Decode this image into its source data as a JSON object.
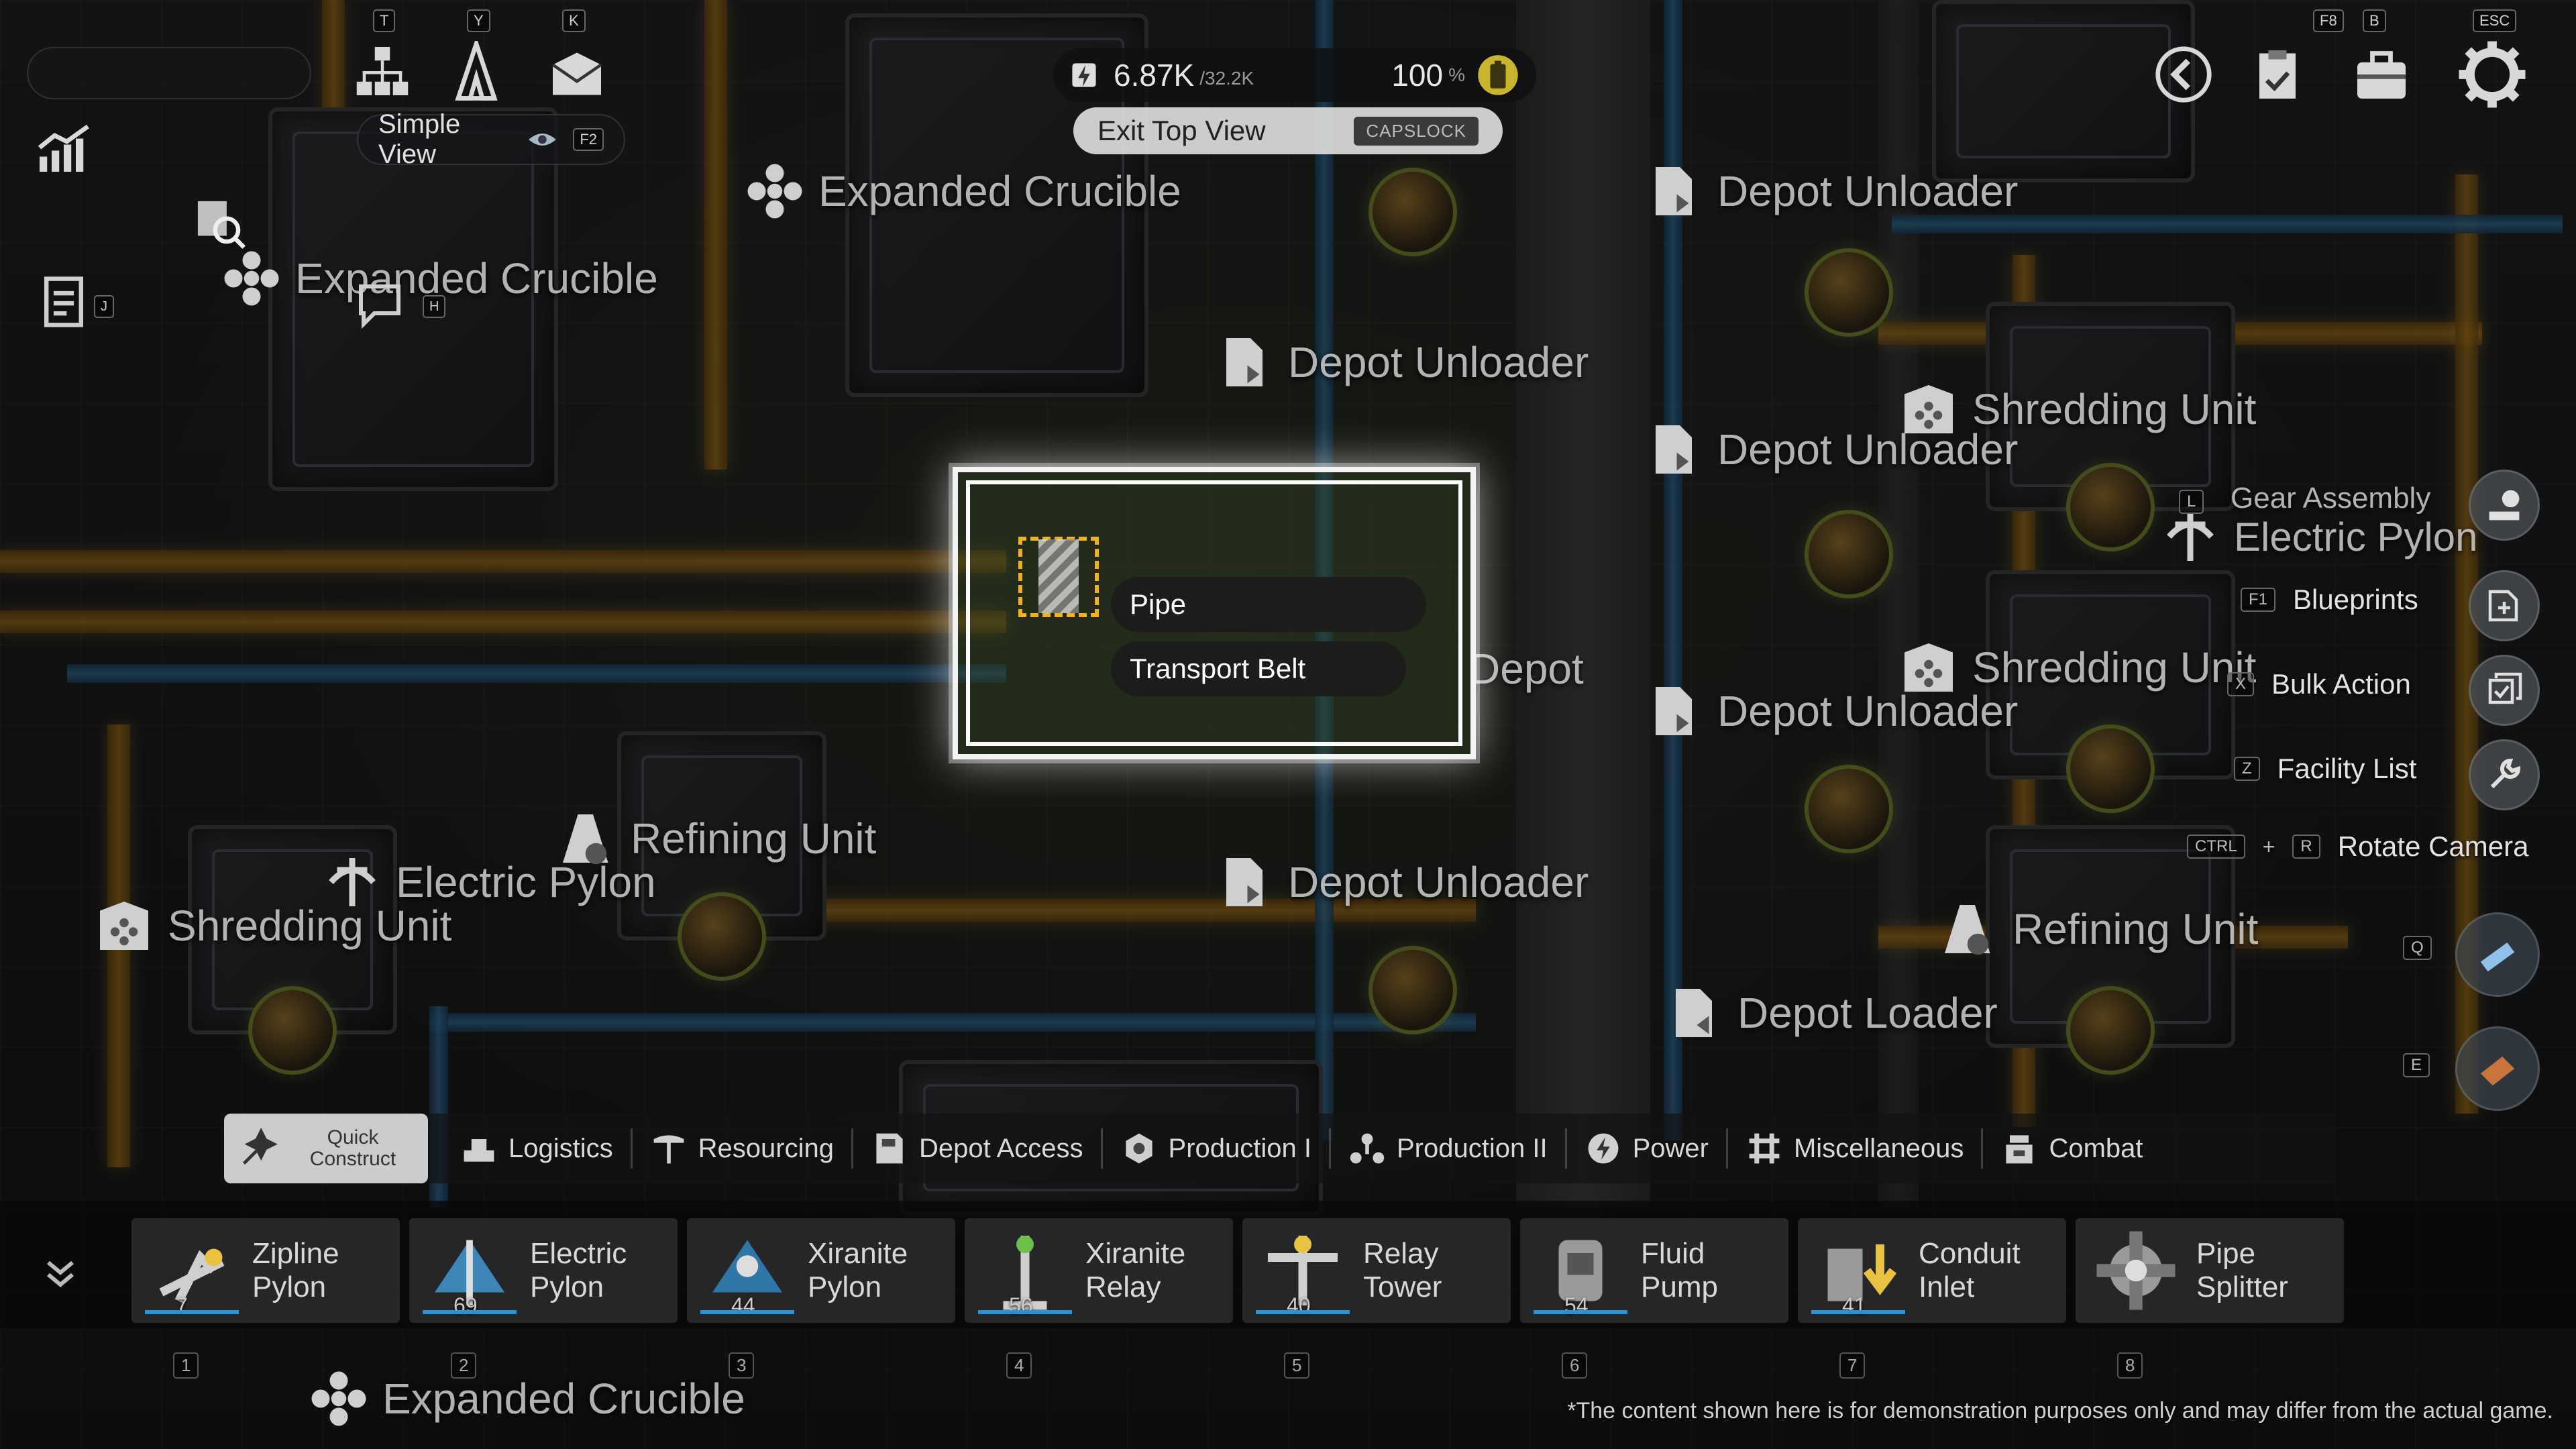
{
  "hud": {
    "hotkeys_top": [
      "T",
      "Y",
      "K"
    ],
    "simple_view_label": "Simple View",
    "simple_view_key": "F2",
    "side_keys": [
      "J",
      "H"
    ],
    "power_value": "6.87K",
    "power_capacity": "/32.2K",
    "battery_percent": "100",
    "battery_unit": "%",
    "exit_top_view_label": "Exit Top View",
    "exit_top_view_key": "CAPSLOCK",
    "top_right_keys": [
      "F8",
      "B",
      "ESC"
    ]
  },
  "world_labels": [
    {
      "text": "Expanded Crucible",
      "icon": "expanded-crucible-icon"
    },
    {
      "text": "Expanded Crucible",
      "icon": "expanded-crucible-icon"
    },
    {
      "text": "Depot Unloader",
      "icon": "depot-unloader-icon"
    },
    {
      "text": "Depot Unloader",
      "icon": "depot-unloader-icon"
    },
    {
      "text": "Depot Unloader",
      "icon": "depot-unloader-icon"
    },
    {
      "text": "Depot Unloader",
      "icon": "depot-unloader-icon"
    },
    {
      "text": "Depot Unloader",
      "icon": "depot-unloader-icon"
    },
    {
      "text": "Depot Unloader",
      "icon": "depot-unloader-icon"
    },
    {
      "text": "Shredding Unit",
      "icon": "shredding-unit-icon"
    },
    {
      "text": "Shredding Unit",
      "icon": "shredding-unit-icon"
    },
    {
      "text": "Shredding Unit",
      "icon": "shredding-unit-icon"
    },
    {
      "text": "Refining Unit",
      "icon": "refining-unit-icon"
    },
    {
      "text": "Refining Unit",
      "icon": "refining-unit-icon"
    },
    {
      "text": "Electric Pylon",
      "icon": "electric-pylon-icon"
    },
    {
      "text": "Electric Pylon",
      "icon": "electric-pylon-icon"
    },
    {
      "text": "Gear Assembly",
      "icon": ""
    },
    {
      "text": "Depot Loader",
      "icon": "depot-loader-icon"
    },
    {
      "text": "Expanded Crucible",
      "icon": "expanded-crucible-icon"
    },
    {
      "text": "Depot",
      "icon": ""
    }
  ],
  "selection": {
    "tooltip_pipe": "Pipe",
    "tooltip_belt": "Transport Belt"
  },
  "right_menu": [
    {
      "key": "F1",
      "label": "Blueprints",
      "icon": "blueprint-add-icon"
    },
    {
      "key": "X",
      "label": "Bulk Action",
      "icon": "bulk-action-icon"
    },
    {
      "key": "Z",
      "label": "Facility List",
      "icon": "facility-list-icon"
    },
    {
      "key": "CTRL",
      "key2": "R",
      "plus": "+",
      "label": "Rotate Camera",
      "icon": "rotate-camera-icon"
    }
  ],
  "right_side_keys": [
    "L",
    "Q",
    "E"
  ],
  "quick_construct_label": "Quick\nConstruct",
  "categories": [
    {
      "label": "Logistics",
      "icon": "logistics-icon"
    },
    {
      "label": "Resourcing",
      "icon": "resourcing-icon"
    },
    {
      "label": "Depot Access",
      "icon": "depot-access-icon"
    },
    {
      "label": "Production I",
      "icon": "production-1-icon"
    },
    {
      "label": "Production II",
      "icon": "production-2-icon"
    },
    {
      "label": "Power",
      "icon": "power-icon"
    },
    {
      "label": "Miscellaneous",
      "icon": "miscellaneous-icon"
    },
    {
      "label": "Combat",
      "icon": "combat-icon"
    }
  ],
  "hotbar": [
    {
      "name": "Zipline\nPylon",
      "count": "7",
      "slot": "1",
      "icon": "zipline-pylon-icon"
    },
    {
      "name": "Electric\nPylon",
      "count": "69",
      "slot": "2",
      "icon": "electric-pylon-icon"
    },
    {
      "name": "Xiranite\nPylon",
      "count": "44",
      "slot": "3",
      "icon": "xiranite-pylon-icon"
    },
    {
      "name": "Xiranite\nRelay",
      "count": "56",
      "slot": "4",
      "icon": "xiranite-relay-icon"
    },
    {
      "name": "Relay\nTower",
      "count": "40",
      "slot": "5",
      "icon": "relay-tower-icon"
    },
    {
      "name": "Fluid Pump",
      "count": "54",
      "slot": "6",
      "icon": "fluid-pump-icon"
    },
    {
      "name": "Conduit\nInlet",
      "count": "41",
      "slot": "7",
      "icon": "conduit-inlet-icon"
    },
    {
      "name": "Pipe\nSplitter",
      "count": "",
      "slot": "8",
      "icon": "pipe-splitter-icon"
    }
  ],
  "disclaimer": "*The content shown here is for demonstration purposes only and may differ from the actual game.",
  "colors": {
    "belt": "#a3721a",
    "pipe": "#2f6a92",
    "highlight": "#f3f3f3",
    "battery": "#c9b52a",
    "count_bar": "#2a93d5"
  }
}
